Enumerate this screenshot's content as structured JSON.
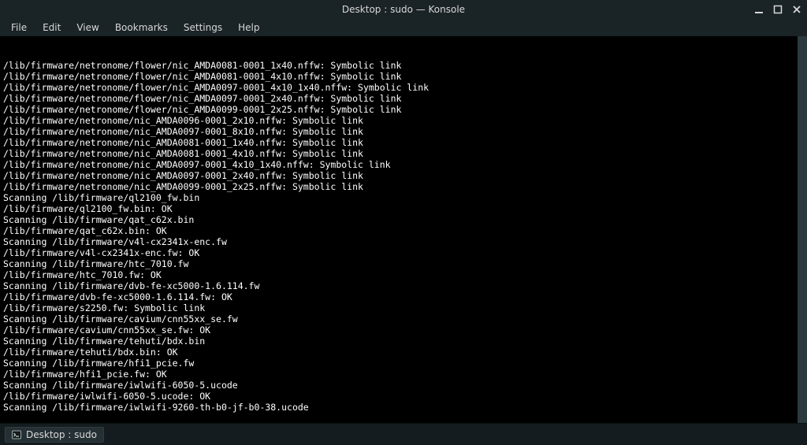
{
  "titlebar": {
    "title": "Desktop : sudo — Konsole"
  },
  "menu": {
    "file": "File",
    "edit": "Edit",
    "view": "View",
    "bookmarks": "Bookmarks",
    "settings": "Settings",
    "help": "Help"
  },
  "terminal": {
    "lines": [
      "/lib/firmware/netronome/flower/nic_AMDA0081-0001_1x40.nffw: Symbolic link",
      "/lib/firmware/netronome/flower/nic_AMDA0081-0001_4x10.nffw: Symbolic link",
      "/lib/firmware/netronome/flower/nic_AMDA0097-0001_4x10_1x40.nffw: Symbolic link",
      "/lib/firmware/netronome/flower/nic_AMDA0097-0001_2x40.nffw: Symbolic link",
      "/lib/firmware/netronome/flower/nic_AMDA0099-0001_2x25.nffw: Symbolic link",
      "/lib/firmware/netronome/nic_AMDA0096-0001_2x10.nffw: Symbolic link",
      "/lib/firmware/netronome/nic_AMDA0097-0001_8x10.nffw: Symbolic link",
      "/lib/firmware/netronome/nic_AMDA0081-0001_1x40.nffw: Symbolic link",
      "/lib/firmware/netronome/nic_AMDA0081-0001_4x10.nffw: Symbolic link",
      "/lib/firmware/netronome/nic_AMDA0097-0001_4x10_1x40.nffw: Symbolic link",
      "/lib/firmware/netronome/nic_AMDA0097-0001_2x40.nffw: Symbolic link",
      "/lib/firmware/netronome/nic_AMDA0099-0001_2x25.nffw: Symbolic link",
      "Scanning /lib/firmware/ql2100_fw.bin",
      "/lib/firmware/ql2100_fw.bin: OK",
      "Scanning /lib/firmware/qat_c62x.bin",
      "/lib/firmware/qat_c62x.bin: OK",
      "Scanning /lib/firmware/v4l-cx2341x-enc.fw",
      "/lib/firmware/v4l-cx2341x-enc.fw: OK",
      "Scanning /lib/firmware/htc_7010.fw",
      "/lib/firmware/htc_7010.fw: OK",
      "Scanning /lib/firmware/dvb-fe-xc5000-1.6.114.fw",
      "/lib/firmware/dvb-fe-xc5000-1.6.114.fw: OK",
      "/lib/firmware/s2250.fw: Symbolic link",
      "Scanning /lib/firmware/cavium/cnn55xx_se.fw",
      "/lib/firmware/cavium/cnn55xx_se.fw: OK",
      "Scanning /lib/firmware/tehuti/bdx.bin",
      "/lib/firmware/tehuti/bdx.bin: OK",
      "Scanning /lib/firmware/hfi1_pcie.fw",
      "/lib/firmware/hfi1_pcie.fw: OK",
      "Scanning /lib/firmware/iwlwifi-6050-5.ucode",
      "/lib/firmware/iwlwifi-6050-5.ucode: OK",
      "Scanning /lib/firmware/iwlwifi-9260-th-b0-jf-b0-38.ucode"
    ]
  },
  "taskbar": {
    "item_label": "Desktop : sudo"
  }
}
